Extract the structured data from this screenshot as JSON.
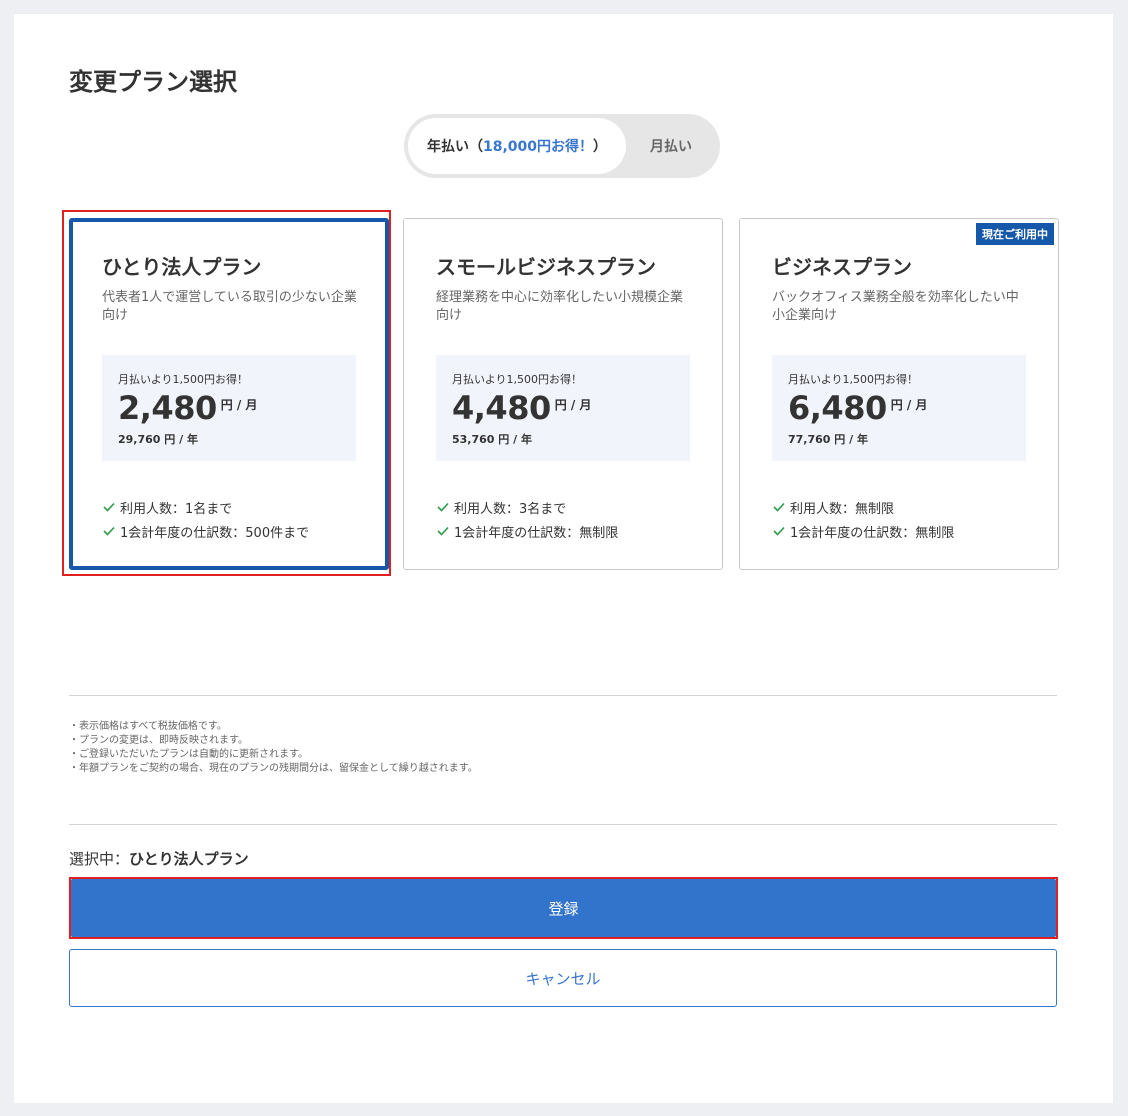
{
  "page": {
    "title": "変更プラン選択"
  },
  "billing_toggle": {
    "annual_prefix": "年払い（",
    "annual_highlight": "18,000円お得！",
    "annual_suffix": "）",
    "monthly_label": "月払い",
    "selected": "annual"
  },
  "plans": [
    {
      "title": "ひとり法人プラン",
      "description": "代表者1人で運営している取引の少ない企業向け",
      "price_note": "月払いより1,500円お得！",
      "price": "2,480",
      "price_unit": "円 / 月",
      "price_year": "29,760 円 / 年",
      "features": [
        "利用人数：1名まで",
        "1会計年度の仕訳数：500件まで"
      ],
      "selected": true
    },
    {
      "title": "スモールビジネスプラン",
      "description": "経理業務を中心に効率化したい小規模企業向け",
      "price_note": "月払いより1,500円お得！",
      "price": "4,480",
      "price_unit": "円 / 月",
      "price_year": "53,760 円 / 年",
      "features": [
        "利用人数：3名まで",
        "1会計年度の仕訳数：無制限"
      ],
      "selected": false
    },
    {
      "title": "ビジネスプラン",
      "description": "バックオフィス業務全般を効率化したい中小企業向け",
      "price_note": "月払いより1,500円お得！",
      "price": "6,480",
      "price_unit": "円 / 月",
      "price_year": "77,760 円 / 年",
      "features": [
        "利用人数：無制限",
        "1会計年度の仕訳数：無制限"
      ],
      "badge": "現在ご利用中",
      "selected": false
    }
  ],
  "notes": [
    "表示価格はすべて税抜価格です。",
    "プランの変更は、即時反映されます。",
    "ご登録いただいたプランは自動的に更新されます。",
    "年額プランをご契約の場合、現在のプランの残期間分は、留保金として繰り越されます。"
  ],
  "selection": {
    "label": "選択中：",
    "plan_name": "ひとり法人プラン"
  },
  "actions": {
    "register_label": "登録",
    "cancel_label": "キャンセル"
  },
  "colors": {
    "primary": "#3274cc",
    "selected_border": "#1558a9",
    "highlight": "#e02020",
    "check": "#2e9a4a"
  },
  "icons": {
    "feature": "check-icon"
  }
}
